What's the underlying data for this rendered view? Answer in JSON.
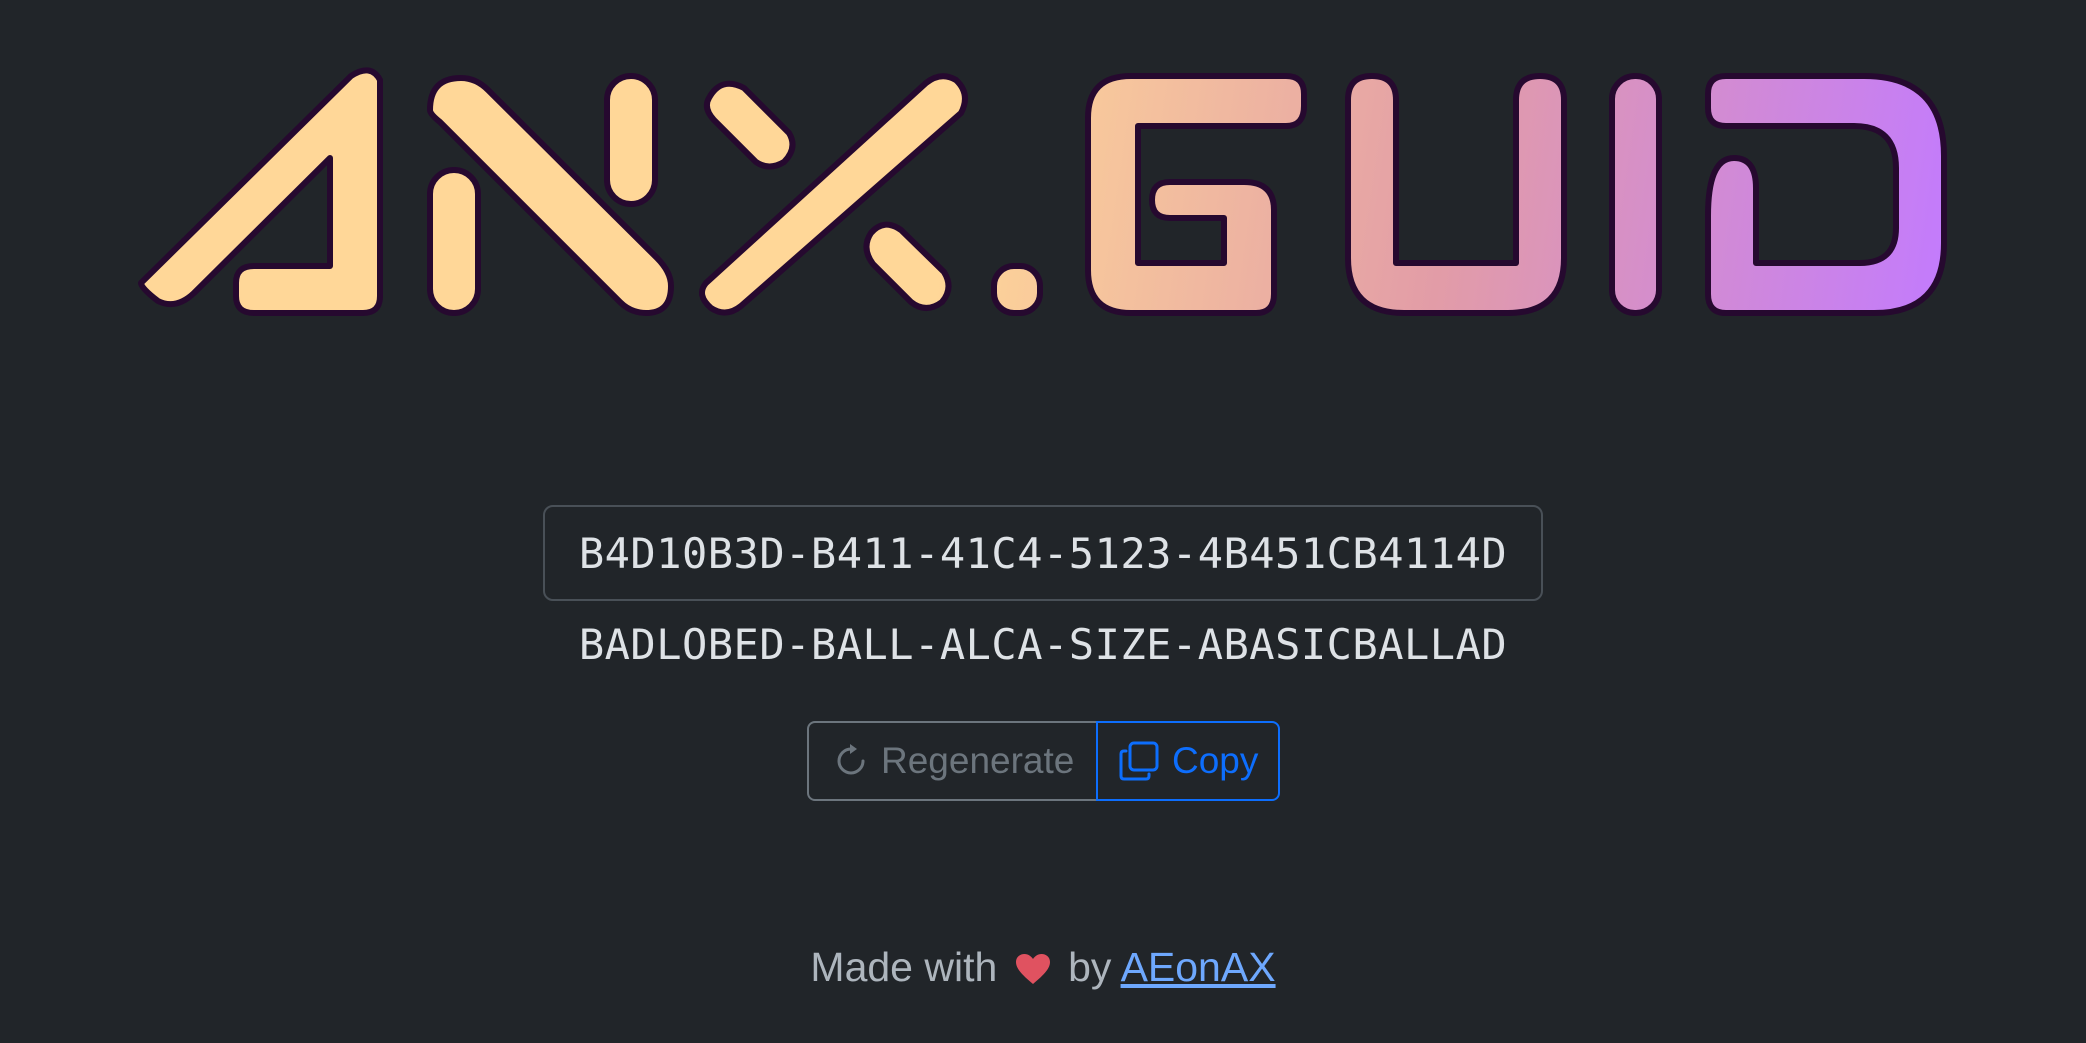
{
  "logo": {
    "text": "AnX.GUID"
  },
  "guid": {
    "value": "B4D10B3D-B411-41C4-5123-4B451CB4114D"
  },
  "words": {
    "value": "BADLOBED-BALL-ALCA-SIZE-ABASICBALLAD"
  },
  "buttons": {
    "regenerate_label": "Regenerate",
    "copy_label": "Copy"
  },
  "footer": {
    "made_with": "Made with",
    "by": "by",
    "author": "AEonAX"
  },
  "icons": {
    "regenerate": "arrow-clockwise-icon",
    "copy": "copy-icon",
    "heart": "heart-icon"
  },
  "colors": {
    "background": "#212529",
    "gradient_start": "#ffd798",
    "gradient_mid": "#e29ca7",
    "gradient_end": "#c27aff",
    "outline": "#26092f",
    "secondary": "#6c757d",
    "primary": "#0d6efd",
    "heart": "#e05260",
    "link": "#6ea8fe"
  }
}
